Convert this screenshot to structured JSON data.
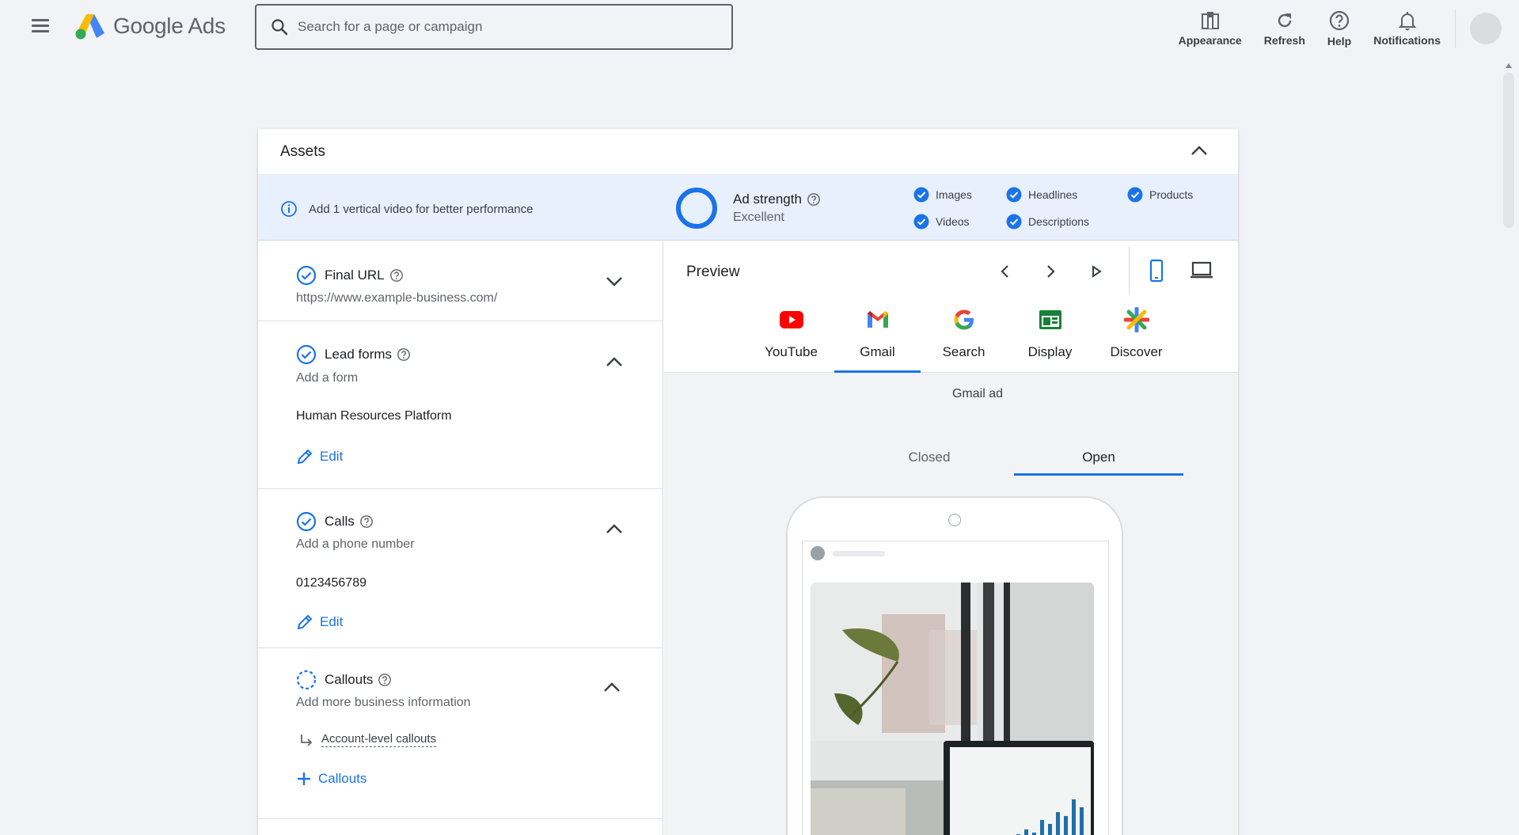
{
  "app": {
    "name": "Google Ads"
  },
  "search": {
    "placeholder": "Search for a page or campaign"
  },
  "top_actions": [
    {
      "label": "Appearance"
    },
    {
      "label": "Refresh"
    },
    {
      "label": "Help"
    },
    {
      "label": "Notifications"
    }
  ],
  "assets": {
    "title": "Assets",
    "info_message": "Add 1 vertical video for better performance",
    "ad_strength": {
      "label": "Ad strength",
      "value": "Excellent"
    },
    "checks": [
      "Images",
      "Headlines",
      "Products",
      "Videos",
      "Descriptions"
    ]
  },
  "sections": {
    "final_url": {
      "title": "Final URL",
      "value": "https://www.example-business.com/"
    },
    "lead_forms": {
      "title": "Lead forms",
      "subtitle": "Add a form",
      "value": "Human Resources Platform",
      "edit": "Edit"
    },
    "calls": {
      "title": "Calls",
      "subtitle": "Add a phone number",
      "value": "0123456789",
      "edit": "Edit"
    },
    "callouts": {
      "title": "Callouts",
      "subtitle": "Add more business information",
      "link": "Account-level callouts",
      "add": "Callouts"
    }
  },
  "preview": {
    "title": "Preview",
    "channels": [
      "YouTube",
      "Gmail",
      "Search",
      "Display",
      "Discover"
    ],
    "active_channel": "Gmail",
    "ad_type": "Gmail ad",
    "view_tabs": [
      "Closed",
      "Open"
    ],
    "active_view": "Open"
  },
  "colors": {
    "accent": "#1a73e8",
    "background": "#f1f3f6"
  }
}
